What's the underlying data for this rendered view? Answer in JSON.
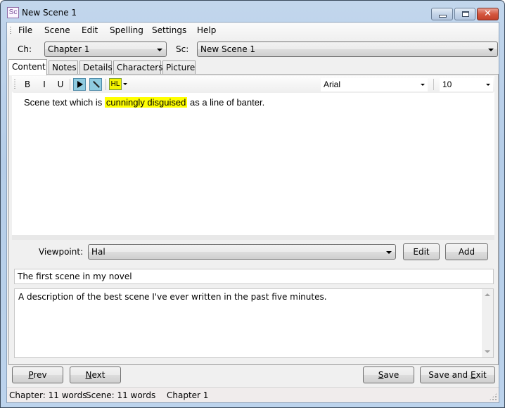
{
  "window": {
    "title": "New Scene 1",
    "app_icon_text": "Sc",
    "controls": {
      "minimize": "minimize",
      "maximize": "maximize",
      "close": "✕"
    }
  },
  "menu": {
    "items": [
      "File",
      "Scene",
      "Edit",
      "Spelling",
      "Settings",
      "Help"
    ]
  },
  "selectors": {
    "chapter_label": "Ch:",
    "chapter_value": "Chapter 1",
    "scene_label": "Sc:",
    "scene_value": "New Scene 1"
  },
  "tabs": [
    {
      "label": "Content",
      "active": true
    },
    {
      "label": "Notes",
      "active": false
    },
    {
      "label": "Details",
      "active": false
    },
    {
      "label": "Characters",
      "active": false
    },
    {
      "label": "Picture",
      "active": false
    }
  ],
  "editor_toolbar": {
    "bold": "B",
    "italic": "I",
    "underline": "U",
    "highlight": "HL",
    "font": "Arial",
    "size": "10"
  },
  "editor": {
    "text_before": "Scene text which is ",
    "text_highlighted": "cunningly disguised",
    "text_after": " as a line of banter.",
    "highlight_color": "#ffff00"
  },
  "viewpoint": {
    "label": "Viewpoint:",
    "value": "Hal",
    "edit_label": "Edit",
    "add_label": "Add"
  },
  "scene_title": "The first scene in my novel",
  "scene_description": "A description of the best scene I've ever written in the past five minutes.",
  "buttons": {
    "prev": {
      "mnemonic": "P",
      "rest": "rev"
    },
    "next": {
      "mnemonic": "N",
      "rest": "ext"
    },
    "save": {
      "mnemonic": "S",
      "rest": "ave"
    },
    "save_exit": {
      "prefix": "Save and ",
      "mnemonic": "E",
      "rest": "xit"
    }
  },
  "status": {
    "chapter_words": "Chapter: 11 words",
    "scene_words": "Scene: 11 words",
    "current_chapter": "Chapter 1"
  }
}
